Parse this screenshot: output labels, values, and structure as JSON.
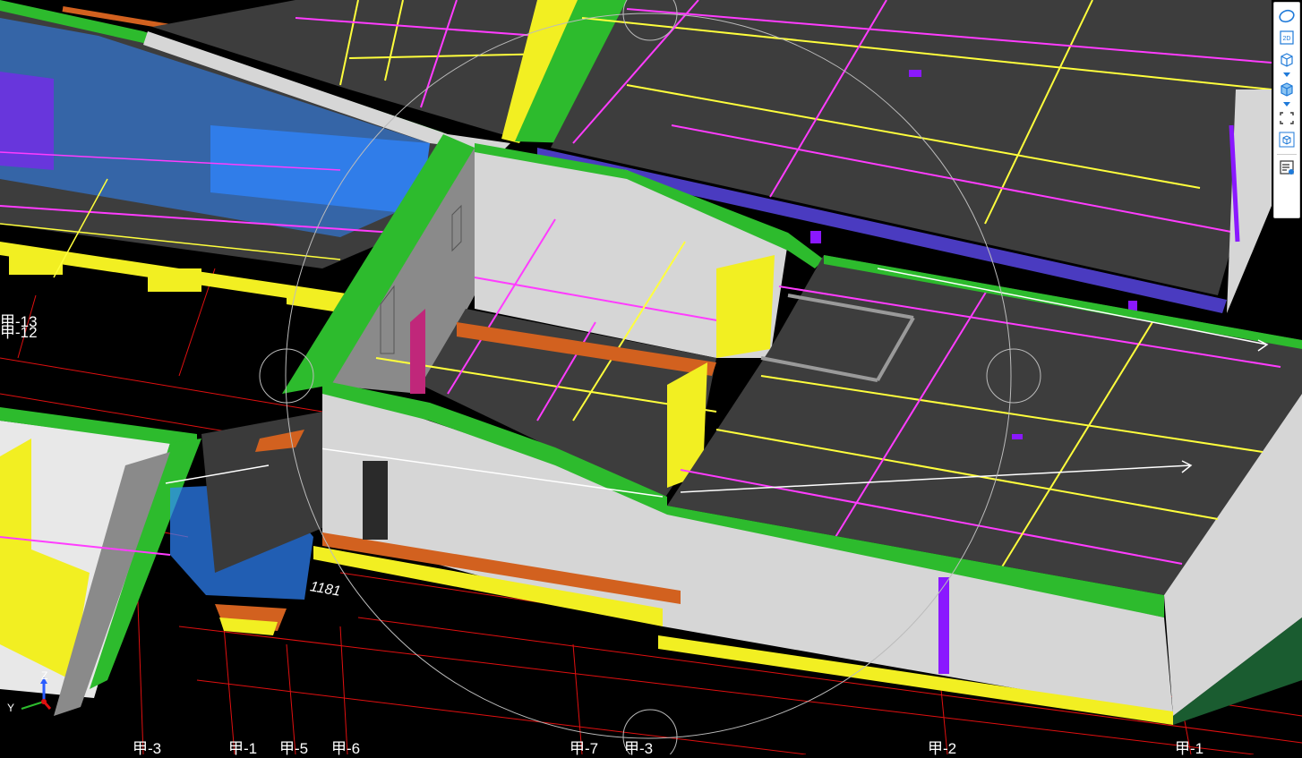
{
  "viewport": {
    "background": "#000000",
    "colors": {
      "slab": "#3d3d3d",
      "wall": "#d6d6d6",
      "beam_green": "#2dbb2d",
      "beam_yellow": "#f2ef22",
      "beam_orange": "#d2611f",
      "grid_magenta": "#ff3cff",
      "grid_yellow": "#ffff3c",
      "axis_red": "#e01010",
      "glass_blue": "#2f86ff",
      "column_purple": "#8a18ff",
      "band_purple": "#4a3bc0"
    },
    "grid_labels": [
      "甲-13",
      "甲-12",
      "甲-3",
      "甲-1",
      "甲-5",
      "甲-6",
      "甲-7",
      "甲-3",
      "甲-2",
      "甲-1"
    ],
    "dimension_label": "1181"
  },
  "axis_gizmo": {
    "z": "Z",
    "y": "Y"
  },
  "toolbar": {
    "buttons": [
      {
        "name": "orbit-icon"
      },
      {
        "name": "view-2d-icon",
        "label": "2D"
      },
      {
        "name": "view-3d-wire-icon"
      },
      {
        "name": "view-3d-solid-icon"
      },
      {
        "name": "fit-view-icon"
      },
      {
        "name": "view-cube-icon"
      },
      {
        "name": "properties-icon"
      }
    ]
  }
}
